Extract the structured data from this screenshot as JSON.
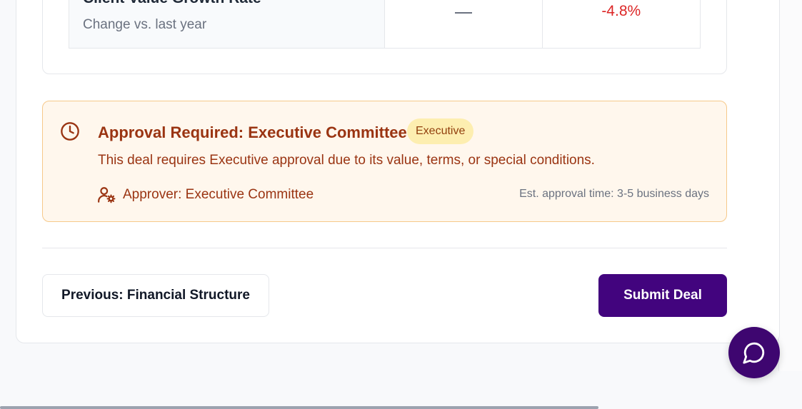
{
  "metric": {
    "title": "Client Value Growth Rate",
    "subtitle": "Change vs. last year",
    "current_value": "",
    "change_value": "-4.8%"
  },
  "approval": {
    "title": "Approval Required: Executive Committee",
    "badge": "Executive",
    "description": "This deal requires Executive approval due to its value, terms, or special conditions.",
    "approver": "Approver: Executive Committee",
    "eta": "Est. approval time: 3-5 business days"
  },
  "actions": {
    "previous_label": "Previous: Financial Structure",
    "submit_label": "Submit Deal"
  },
  "colors": {
    "accent": "#42047e",
    "warning_bg": "#fff7ed",
    "warning_text": "#9a3412",
    "negative": "#dc2626"
  },
  "icons": {
    "approval": "clock-icon",
    "approver": "user-gear-icon",
    "chat": "chat-bubble-icon"
  }
}
